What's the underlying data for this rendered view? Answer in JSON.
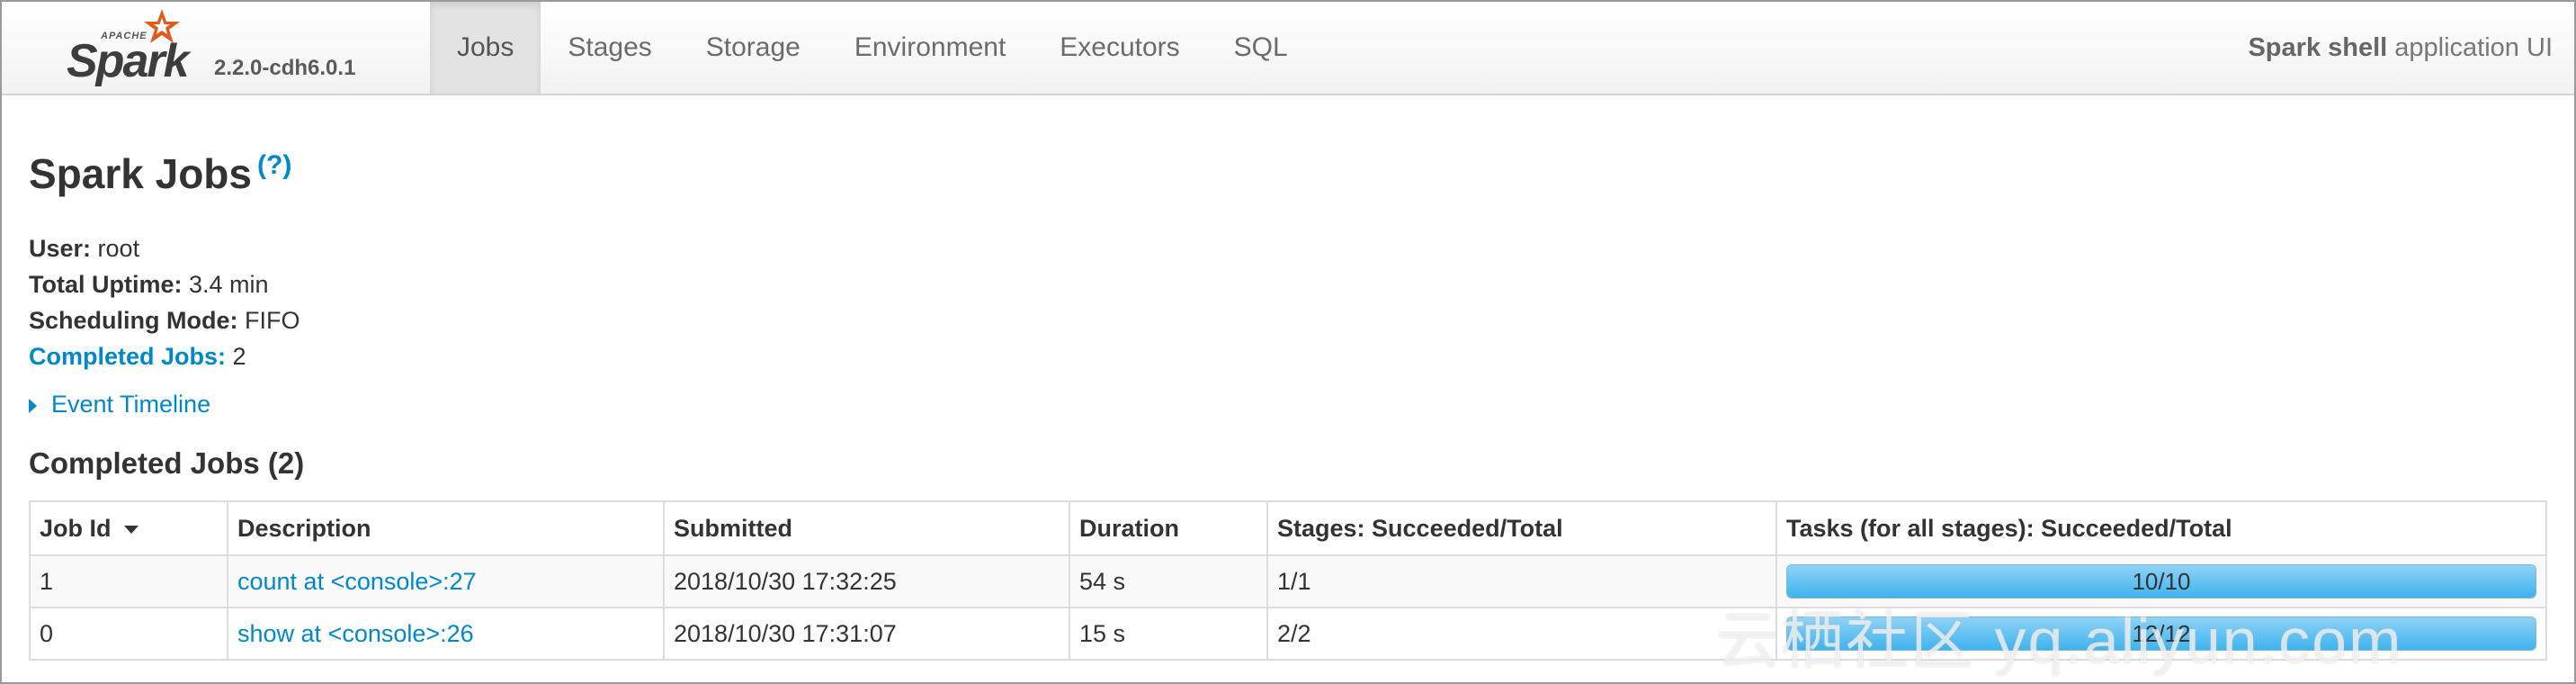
{
  "brand": {
    "apache": "APACHE",
    "spark": "Spark",
    "version": "2.2.0-cdh6.0.1"
  },
  "nav": {
    "tabs": [
      "Jobs",
      "Stages",
      "Storage",
      "Environment",
      "Executors",
      "SQL"
    ],
    "active": "Jobs"
  },
  "app_title": {
    "name": "Spark shell",
    "suffix": "application UI"
  },
  "page": {
    "title": "Spark Jobs",
    "help": "(?)"
  },
  "summary": {
    "user_label": "User:",
    "user_value": "root",
    "uptime_label": "Total Uptime:",
    "uptime_value": "3.4 min",
    "mode_label": "Scheduling Mode:",
    "mode_value": "FIFO",
    "completed_label": "Completed Jobs:",
    "completed_value": "2"
  },
  "timeline_label": "Event Timeline",
  "section_title": "Completed Jobs (2)",
  "table": {
    "headers": [
      "Job Id",
      "Description",
      "Submitted",
      "Duration",
      "Stages: Succeeded/Total",
      "Tasks (for all stages): Succeeded/Total"
    ],
    "rows": [
      {
        "job_id": "1",
        "description": "count at <console>:27",
        "submitted": "2018/10/30 17:32:25",
        "duration": "54 s",
        "stages": "1/1",
        "tasks": "10/10",
        "tasks_fraction": 1.0
      },
      {
        "job_id": "0",
        "description": "show at <console>:26",
        "submitted": "2018/10/30 17:31:07",
        "duration": "15 s",
        "stages": "2/2",
        "tasks": "12/12",
        "tasks_fraction": 1.0
      }
    ]
  },
  "colors": {
    "link": "#0088cc",
    "progress": "#3eb3ee",
    "star": "#e25a1c"
  },
  "watermark": "云栖社区 yq.aliyun.com"
}
